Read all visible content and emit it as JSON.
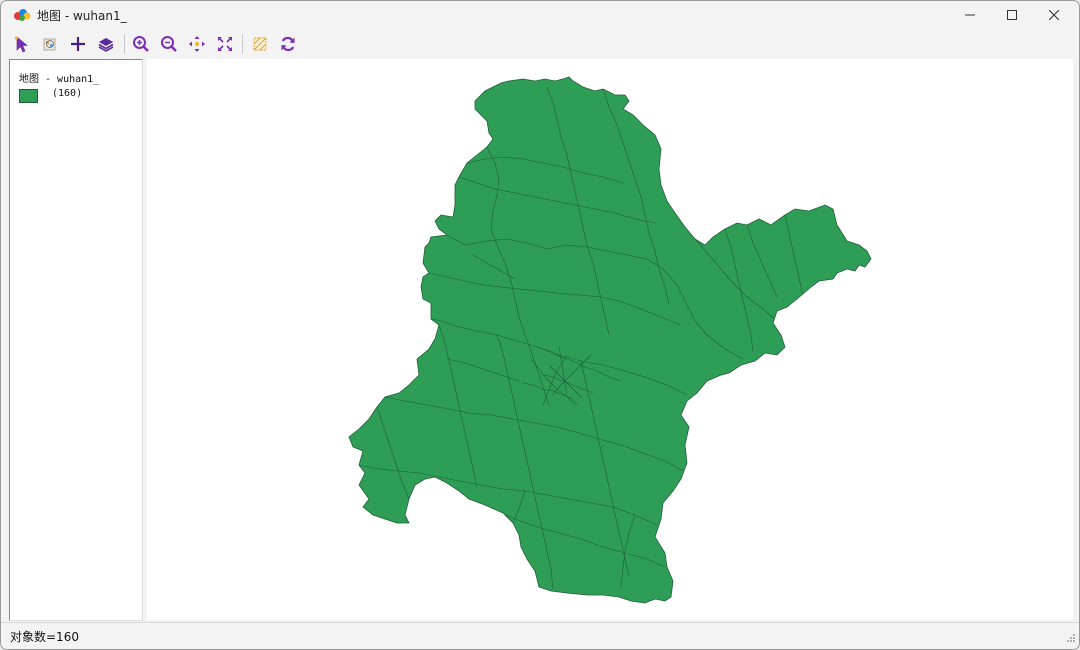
{
  "window": {
    "title": "地图 - wuhan1_"
  },
  "toolbar": {
    "tools": [
      "select-tool",
      "identify-tool",
      "add-tool",
      "layers-tool",
      "zoom-in-tool",
      "zoom-out-tool",
      "pan-tool",
      "full-extent-tool",
      "clear-selection-tool",
      "refresh-tool"
    ],
    "accent": "#7b2fb5"
  },
  "legend": {
    "title": "地图 - wuhan1_",
    "items": [
      {
        "label": "(160)",
        "color": "#2e9e57"
      }
    ]
  },
  "map": {
    "fill": "#2e9e57",
    "stroke": "#1f5e36"
  },
  "status": {
    "text": "对象数=160"
  }
}
